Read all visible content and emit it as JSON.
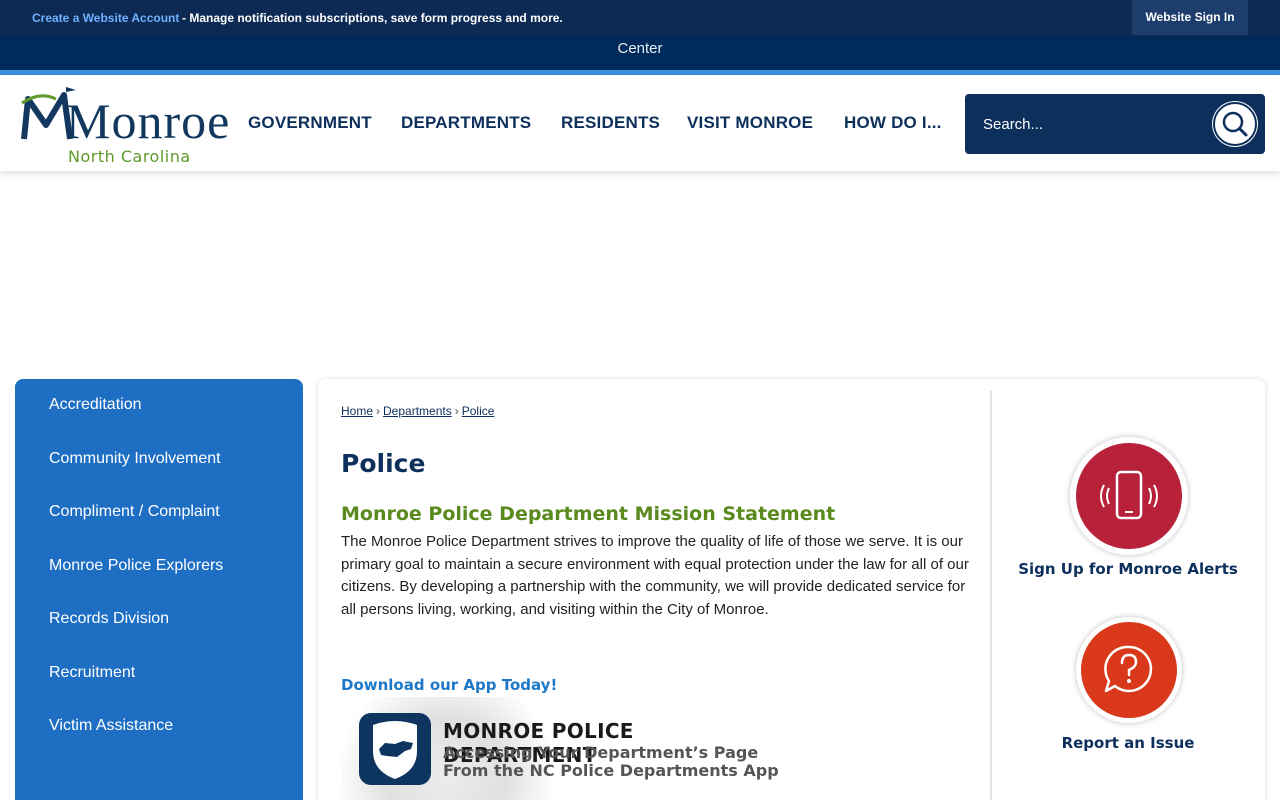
{
  "topbar": {
    "create_link": "Create a Website Account",
    "manage_text": "- Manage notification subscriptions, save form progress and more.",
    "signin_label": "Website Sign In"
  },
  "center_strip": {
    "text": "Center"
  },
  "logo": {
    "name": "Monroe",
    "state": "North Carolina"
  },
  "nav": {
    "items": [
      "GOVERNMENT",
      "DEPARTMENTS",
      "RESIDENTS",
      "VISIT MONROE",
      "HOW DO I..."
    ]
  },
  "search": {
    "placeholder": "Search..."
  },
  "sidebar": {
    "items": [
      "Accreditation",
      "Community Involvement",
      "Compliment / Complaint",
      "Monroe Police Explorers",
      "Records Division",
      "Recruitment",
      "Victim Assistance"
    ]
  },
  "breadcrumb": {
    "home": "Home",
    "departments": "Departments",
    "police": "Police",
    "separator": "›"
  },
  "main": {
    "title": "Police",
    "mission_title": "Monroe Police Department Mission Statement",
    "mission_text": "The Monroe Police Department strives to improve the quality of life of those we serve. It is our primary goal to maintain a secure environment with equal protection under the law for all of our citizens. By developing a partnership with the community, we will provide dedicated service for all persons living, working, and visiting within the City of Monroe.",
    "app_link": "Download our App Today!",
    "banner": {
      "title": "MONROE POLICE DEPARTMENT",
      "line1": "Accessing Your Department’s Page",
      "line2": "From the NC Police Departments App"
    }
  },
  "quick_links": {
    "alerts_label": "Sign Up for Monroe Alerts",
    "report_label": "Report an Issue"
  },
  "colors": {
    "navy": "#0d2f5c",
    "sidebar_blue": "#1e6fc4",
    "green": "#5a8a1e",
    "alerts_red": "#b8213a",
    "report_orange": "#d9391a"
  },
  "icons": {
    "alerts": "phone-vibrate-icon",
    "report": "question-speech-bubble-icon",
    "search": "search-icon"
  }
}
